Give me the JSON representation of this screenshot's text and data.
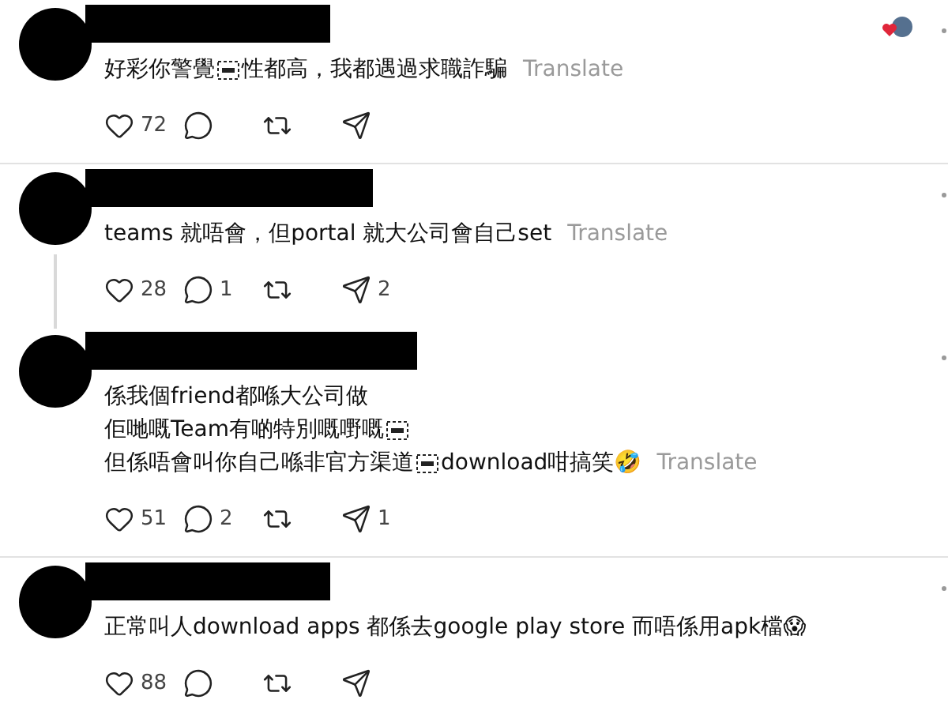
{
  "comments": [
    {
      "lines": [
        [
          {
            "kind": "text",
            "text": "好彩你警覺"
          },
          {
            "kind": "obj"
          },
          {
            "kind": "text",
            "text": "性都高，我都遇過求職詐騙"
          }
        ]
      ],
      "translate": "Translate",
      "author_liked": true,
      "actions": {
        "likes": "72"
      }
    },
    {
      "lines": [
        [
          {
            "kind": "text",
            "text": "teams 就唔會，但portal 就大公司會自己set"
          }
        ]
      ],
      "translate": "Translate",
      "threaded": true,
      "divider_above": true,
      "actions": {
        "likes": "28",
        "replies": "1",
        "shares": "2"
      }
    },
    {
      "lines": [
        [
          {
            "kind": "text",
            "text": "係我個friend都喺大公司做"
          }
        ],
        [
          {
            "kind": "text",
            "text": "佢哋嘅Team有啲特別嘅嘢嘅"
          },
          {
            "kind": "obj"
          }
        ],
        [
          {
            "kind": "text",
            "text": "但係唔會叫你自己喺非官方渠道"
          },
          {
            "kind": "obj"
          },
          {
            "kind": "text",
            "text": "download咁搞笑🤣"
          }
        ]
      ],
      "translate": "Translate",
      "actions": {
        "likes": "51",
        "replies": "2",
        "shares": "1"
      }
    },
    {
      "lines": [
        [
          {
            "kind": "text",
            "text": "正常叫人download apps 都係去google play store 而唔係用apk檔😱"
          }
        ]
      ],
      "divider_above": true,
      "actions": {
        "likes": "88"
      }
    }
  ]
}
